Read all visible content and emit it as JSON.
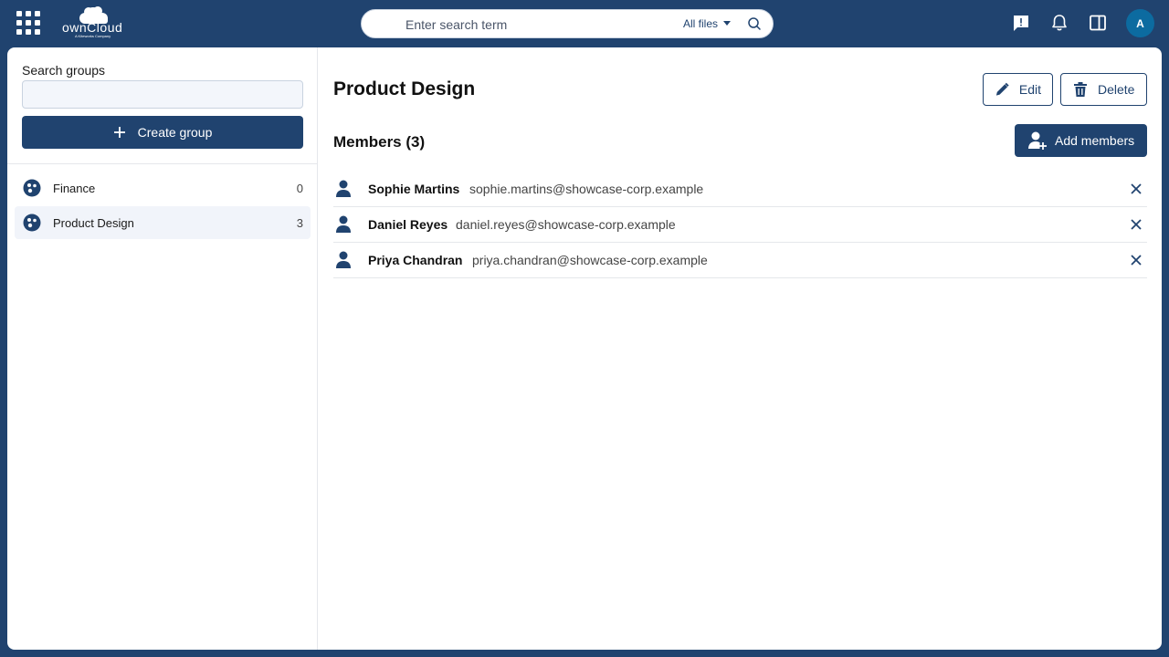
{
  "header": {
    "search_placeholder": "Enter search term",
    "filter_label": "All files",
    "avatar_initial": "A",
    "logo_text": "ownCloud",
    "logo_subtext": "A Kiteworks Company"
  },
  "sidebar": {
    "search_label": "Search groups",
    "search_value": "",
    "create_label": "Create group",
    "groups": [
      {
        "name": "Finance",
        "count": "0",
        "active": false
      },
      {
        "name": "Product Design",
        "count": "3",
        "active": true
      }
    ]
  },
  "main": {
    "title": "Product Design",
    "edit_label": "Edit",
    "delete_label": "Delete",
    "members_heading": "Members (3)",
    "add_members_label": "Add members",
    "members": [
      {
        "name": "Sophie Martins",
        "email": "sophie.martins@showcase-corp.example"
      },
      {
        "name": "Daniel Reyes",
        "email": "daniel.reyes@showcase-corp.example"
      },
      {
        "name": "Priya Chandran",
        "email": "priya.chandran@showcase-corp.example"
      }
    ]
  },
  "colors": {
    "brand": "#20436f",
    "avatar": "#0c6ba0",
    "active_row": "#f1f4fa"
  },
  "icons": [
    "app-switcher-icon",
    "search-icon",
    "chevron-down-icon",
    "feedback-icon",
    "bell-icon",
    "sidebar-panel-icon",
    "plus-icon",
    "group-icon",
    "pencil-icon",
    "trash-icon",
    "add-user-icon",
    "user-icon",
    "close-icon"
  ]
}
